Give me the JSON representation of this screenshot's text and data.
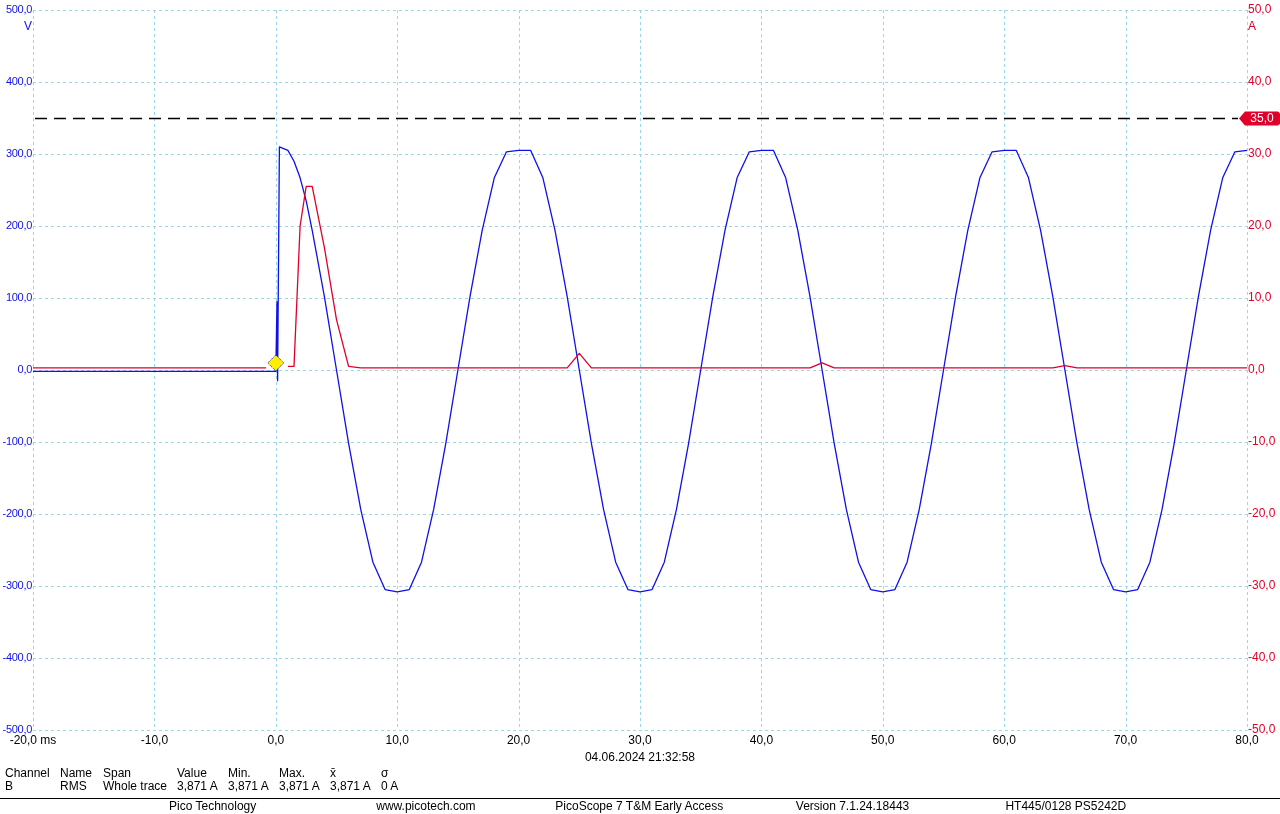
{
  "scope": {
    "chart_data": {
      "type": "line",
      "ylabel": "V",
      "xlim": [
        -20,
        80
      ],
      "ylim": [
        -500,
        500
      ],
      "xticks": [
        {
          "value": -20,
          "label": "-20,0 ms"
        },
        {
          "value": -10,
          "label": "-10,0"
        },
        {
          "value": 0,
          "label": "0,0"
        },
        {
          "value": 10,
          "label": "10,0"
        },
        {
          "value": 20,
          "label": "20,0"
        },
        {
          "value": 30,
          "label": "30,0"
        },
        {
          "value": 40,
          "label": "40,0"
        },
        {
          "value": 50,
          "label": "50,0"
        },
        {
          "value": 60,
          "label": "60,0"
        },
        {
          "value": 70,
          "label": "70,0"
        },
        {
          "value": 80,
          "label": "80,0"
        }
      ],
      "yticks": [
        {
          "value": 500,
          "label": "500,0"
        },
        {
          "value": 400,
          "label": "400,0"
        },
        {
          "value": 300,
          "label": "300,0"
        },
        {
          "value": 200,
          "label": "200,0"
        },
        {
          "value": 100,
          "label": "100,0"
        },
        {
          "value": 0,
          "label": "0,0"
        },
        {
          "value": -100,
          "label": "-100,0"
        },
        {
          "value": -200,
          "label": "-200,0"
        },
        {
          "value": -300,
          "label": "-300,0"
        },
        {
          "value": -400,
          "label": "-400,0"
        },
        {
          "value": -500,
          "label": "-500,0"
        }
      ],
      "y2label": "A",
      "y2lim": [
        -50,
        50
      ],
      "y2ticks": [
        {
          "value": 50,
          "label": "50,0"
        },
        {
          "value": 40,
          "label": "40,0"
        },
        {
          "value": 30,
          "label": "30,0"
        },
        {
          "value": 20,
          "label": "20,0"
        },
        {
          "value": 10,
          "label": "10,0"
        },
        {
          "value": 0,
          "label": "0,0"
        },
        {
          "value": -10,
          "label": "-10,0"
        },
        {
          "value": -20,
          "label": "-20,0"
        },
        {
          "value": -30,
          "label": "-30,0"
        },
        {
          "value": -40,
          "label": "-40,0"
        },
        {
          "value": -50,
          "label": "-50,0"
        }
      ],
      "x": [
        -20,
        -10,
        -0.8,
        0,
        0.1,
        0.15,
        0.3,
        1,
        1.5,
        2,
        2.5,
        3,
        4,
        5,
        6,
        7,
        8,
        9,
        10,
        11,
        12,
        13,
        14,
        15,
        16,
        17,
        18,
        19,
        20,
        21,
        22,
        23,
        24,
        25,
        26,
        27,
        28,
        29,
        30,
        31,
        32,
        33,
        34,
        35,
        36,
        37,
        38,
        39,
        40,
        41,
        42,
        43,
        44,
        45,
        46,
        47,
        48,
        49,
        50,
        51,
        52,
        53,
        54,
        55,
        56,
        57,
        58,
        59,
        60,
        61,
        62,
        63,
        64,
        65,
        66,
        67,
        68,
        69,
        70,
        71,
        72,
        73,
        74,
        75,
        76,
        77,
        78,
        79,
        80
      ],
      "series": [
        {
          "color": "#1010e8",
          "values": [
            -2,
            -2,
            -2,
            -2,
            95,
            -15,
            310,
            305,
            290,
            267,
            235,
            194,
            102,
            0,
            -102,
            -194,
            -267,
            -305,
            -308,
            -305,
            -267,
            -194,
            -102,
            0,
            102,
            194,
            267,
            303,
            305,
            305,
            267,
            194,
            102,
            0,
            -102,
            -194,
            -267,
            -305,
            -308,
            -305,
            -267,
            -194,
            -102,
            0,
            102,
            194,
            267,
            303,
            305,
            305,
            267,
            194,
            102,
            0,
            -102,
            -194,
            -267,
            -305,
            -308,
            -305,
            -267,
            -194,
            -102,
            0,
            102,
            194,
            267,
            303,
            305,
            305,
            267,
            194,
            102,
            0,
            -102,
            -194,
            -267,
            -305,
            -308,
            -305,
            -267,
            -194,
            -102,
            0,
            102,
            194,
            267,
            303,
            305
          ]
        },
        {
          "axis": "y2",
          "color": "#e0002a",
          "values": [
            0.3,
            0.3,
            0.3,
            null,
            null,
            null,
            null,
            0.5,
            0.5,
            20,
            25.5,
            25.5,
            17,
            7,
            0.5,
            0.3,
            0.3,
            0.3,
            0.3,
            0.3,
            0.3,
            0.3,
            0.3,
            0.3,
            0.3,
            0.3,
            0.3,
            0.3,
            0.3,
            0.3,
            0.3,
            0.3,
            0.3,
            2.3,
            0.3,
            0.3,
            0.3,
            0.3,
            0.3,
            0.3,
            0.3,
            0.3,
            0.3,
            0.3,
            0.3,
            0.3,
            0.3,
            0.3,
            0.3,
            0.3,
            0.3,
            0.3,
            0.3,
            1,
            0.3,
            0.3,
            0.3,
            0.3,
            0.3,
            0.3,
            0.3,
            0.3,
            0.3,
            0.3,
            0.3,
            0.3,
            0.3,
            0.3,
            0.3,
            0.3,
            0.3,
            0.3,
            0.3,
            0.6,
            0.3,
            0.3,
            0.3,
            0.3,
            0.3,
            0.3,
            0.3,
            0.3,
            0.3,
            0.3,
            0.3,
            0.3,
            0.3,
            0.3,
            0.3
          ]
        }
      ],
      "ref_lines": [
        {
          "axis": "y2",
          "value": 35,
          "label": "35,0"
        }
      ],
      "grid": true
    },
    "timestamp": "04.06.2024 21:32:58"
  },
  "measurements": {
    "columns": [
      "Channel",
      "Name",
      "Span",
      "Value",
      "Min.",
      "Max.",
      "x̄",
      "σ"
    ],
    "rows": [
      [
        "B",
        "RMS",
        "Whole trace",
        "3,871 A",
        "3,871 A",
        "3,871 A",
        "3,871 A",
        "0 A"
      ]
    ]
  },
  "status_bar": [
    "Pico Technology",
    "www.picotech.com",
    "PicoScope 7 T&M Early Access",
    "Version 7.1.24.18443",
    "HT445/0128 PS5242D"
  ]
}
